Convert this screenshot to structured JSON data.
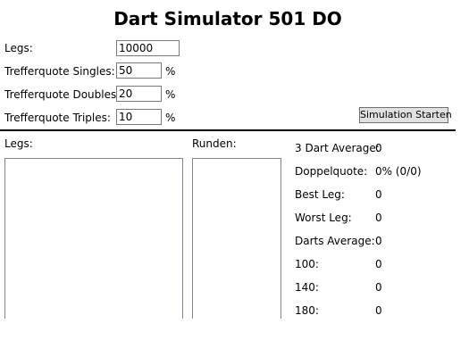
{
  "window": {
    "title": "Dart Simulator 501 DO"
  },
  "settings": {
    "legs_label": "Legs:",
    "legs_value": "10000",
    "singles_label": "Trefferquote Singles:",
    "singles_value": "50",
    "doubles_label": "Trefferquote Doubles:",
    "doubles_value": "20",
    "triples_label": "Trefferquote Triples:",
    "triples_value": "10",
    "percent_unit": "%"
  },
  "toolbar": {
    "start_label": "Simulation Starten"
  },
  "lists": {
    "legs_header": "Legs:",
    "runden_header": "Runden:"
  },
  "stats": {
    "three_dart_average_label": "3 Dart Average:",
    "three_dart_average_value": "0",
    "doppelquote_label": "Doppelquote:",
    "doppelquote_value": "0% (0/0)",
    "best_leg_label": "Best Leg:",
    "best_leg_value": "0",
    "worst_leg_label": "Worst Leg:",
    "worst_leg_value": "0",
    "darts_average_label": "Darts Average:",
    "darts_average_value": "0",
    "s100_label": "100:",
    "s100_value": "0",
    "s140_label": "140:",
    "s140_value": "0",
    "s180_label": "180:",
    "s180_value": "0"
  }
}
